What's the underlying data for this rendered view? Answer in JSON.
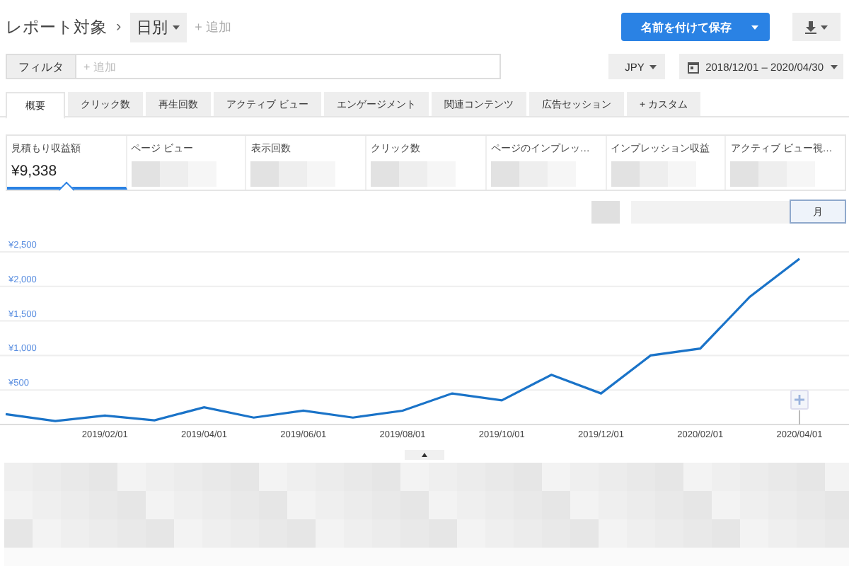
{
  "header": {
    "title": "レポート対象",
    "separator": "›",
    "grouping": "日別",
    "add_link": "+ 追加",
    "save_button": "名前を付けて保存"
  },
  "filter": {
    "label": "フィルタ",
    "placeholder": "+ 追加",
    "currency": "JPY",
    "date_range": "2018/12/01 – 2020/04/30"
  },
  "tabs": [
    {
      "label": "概要",
      "selected": true
    },
    {
      "label": "クリック数",
      "selected": false
    },
    {
      "label": "再生回数",
      "selected": false
    },
    {
      "label": "アクティブ ビュー",
      "selected": false
    },
    {
      "label": "エンゲージメント",
      "selected": false
    },
    {
      "label": "関連コンテンツ",
      "selected": false
    },
    {
      "label": "広告セッション",
      "selected": false
    },
    {
      "label": "+ カスタム",
      "selected": false
    }
  ],
  "metrics": [
    {
      "label": "見積もり収益額",
      "value": "¥9,338",
      "selected": true
    },
    {
      "label": "ページ ビュー",
      "selected": false
    },
    {
      "label": "表示回数",
      "selected": false
    },
    {
      "label": "クリック数",
      "selected": false
    },
    {
      "label": "ページのインプレッ…",
      "selected": false
    },
    {
      "label": "インプレッション収益",
      "selected": false
    },
    {
      "label": "アクティブ ビュー視…",
      "selected": false
    }
  ],
  "period_buttons": [
    {
      "label": "月",
      "selected": true
    }
  ],
  "chart": {
    "chart_data": {
      "type": "line",
      "grid": true,
      "categories": [
        null,
        null,
        "2019/02/01",
        null,
        "2019/04/01",
        null,
        "2019/06/01",
        null,
        "2019/08/01",
        null,
        "2019/10/01",
        null,
        "2019/12/01",
        null,
        "2020/02/01",
        null,
        "2020/04/01"
      ],
      "ylim": [
        0,
        2500
      ],
      "series": [
        {
          "color": "#1a73c8",
          "values": [
            150,
            50,
            130,
            60,
            250,
            100,
            200,
            100,
            200,
            450,
            350,
            720,
            450,
            1000,
            1100,
            1850,
            2400
          ]
        }
      ],
      "yticks": [
        {
          "value": 500,
          "label": "¥500"
        },
        {
          "value": 1000,
          "label": "¥1,000"
        },
        {
          "value": 1500,
          "label": "¥1,500"
        },
        {
          "value": 2000,
          "label": "¥2,000"
        },
        {
          "value": 2500,
          "label": "¥2,500"
        }
      ]
    }
  }
}
